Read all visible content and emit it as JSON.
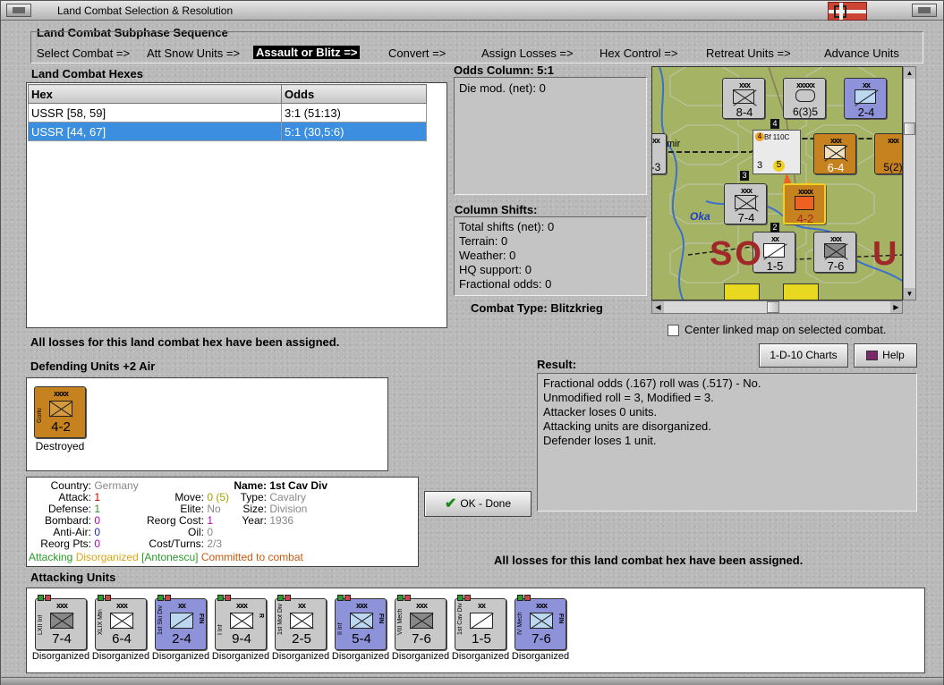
{
  "window": {
    "title": "Land Combat Selection & Resolution"
  },
  "subphase": {
    "heading": "Land Combat Subphase Sequence",
    "steps": [
      "Select Combat =>",
      "Att Snow Units =>",
      "Assault or Blitz =>",
      "Convert =>",
      "Assign Losses =>",
      "Hex Control =>",
      "Retreat Units =>",
      "Advance Units"
    ]
  },
  "hexes": {
    "heading": "Land Combat Hexes",
    "columns": [
      "Hex",
      "Odds"
    ],
    "rows": [
      {
        "hex": "USSR [58, 59]",
        "odds": "3:1 (51:13)"
      },
      {
        "hex": "USSR [44, 67]",
        "odds": "5:1 (30,5:6)"
      }
    ]
  },
  "odds": {
    "heading": "Odds Column: 5:1",
    "die_mod": "Die mod. (net): 0"
  },
  "shifts": {
    "heading": "Column Shifts:",
    "lines": [
      "Total shifts (net): 0",
      "Terrain: 0",
      "Weather: 0",
      "HQ support: 0",
      "Fractional odds: 0"
    ]
  },
  "combat_type": "Combat Type:  Blitzkrieg",
  "map": {
    "label_city": "mir",
    "label_river": "Oka",
    "label_region": "SO",
    "label_region2": "U",
    "aircraft": "Bf 110C",
    "counters": [
      {
        "str": "8-4",
        "size": "xxx"
      },
      {
        "str": "6(3)5",
        "size": "xxxxx"
      },
      {
        "str": "2-4",
        "size": "xx"
      },
      {
        "str": "6-4",
        "size": "xxx"
      },
      {
        "str": "5(2)",
        "size": "xxx"
      },
      {
        "str": "-3",
        "size": "xx"
      },
      {
        "str": "7-4",
        "size": "xxx"
      },
      {
        "str": "4-2",
        "size": "xxxx"
      },
      {
        "str": "1-5",
        "size": "xx"
      },
      {
        "str": "7-6",
        "size": "xxx"
      }
    ],
    "stack_numbers": [
      "4",
      "5",
      "3",
      "2",
      "4",
      "3"
    ]
  },
  "center_map": "Center linked map on selected combat.",
  "buttons": {
    "charts": "1-D-10 Charts",
    "help": "Help",
    "ok": "OK - Done"
  },
  "losses_msg_top": "All losses for this land combat hex have been assigned.",
  "losses_msg_bottom": "All losses for this land combat hex have been assigned.",
  "defending": {
    "heading": "Defending Units +2 Air",
    "unit": {
      "size": "xxxx",
      "side": "Gorki",
      "str": "4-2",
      "status": "Destroyed"
    }
  },
  "result": {
    "heading": "Result:",
    "lines": [
      "Fractional odds (.167) roll was (.517)  - No.",
      "Unmodified roll = 3, Modified = 3.",
      "Attacker loses 0 units.",
      "Attacking units are disorganized.",
      "Defender loses 1 unit."
    ]
  },
  "unit_info": {
    "country_label": "Country:",
    "country": "Germany",
    "attack_label": "Attack:",
    "attack": "1",
    "defense_label": "Defense:",
    "defense": "1",
    "bombard_label": "Bombard:",
    "bombard": "0",
    "antiair_label": "Anti-Air:",
    "antiair": "0",
    "reorgpts_label": "Reorg Pts:",
    "reorgpts": "0",
    "move_label": "Move:",
    "move": "0 (5)",
    "elite_label": "Elite:",
    "elite": "No",
    "reorgcost_label": "Reorg Cost:",
    "reorgcost": "1",
    "oil_label": "Oil:",
    "oil": "0",
    "costturns_label": "Cost/Turns:",
    "costturns": "2/3",
    "name_label": "Name:",
    "name": "1st Cav Div",
    "type_label": "Type:",
    "type": "Cavalry",
    "size_label": "Size:",
    "size": "Division",
    "year_label": "Year:",
    "year": "1936",
    "flag_attacking": "Attacking",
    "flag_disorganized": "Disorganized",
    "flag_antonescu": "[Antonescu]",
    "flag_committed": "Committed to combat",
    "colors": {
      "attacking": "#2a9a2a",
      "disorganized": "#d9a516",
      "antonescu": "#2a9a2a",
      "committed": "#c85a10"
    }
  },
  "attacking": {
    "heading": "Attacking Units",
    "units": [
      {
        "side": "LXII Inf",
        "size": "xxx",
        "str": "7-4",
        "status": "Disorganized",
        "nat": ""
      },
      {
        "side": "XLIX Mtn",
        "size": "xxx",
        "str": "6-4",
        "status": "Disorganized",
        "nat": ""
      },
      {
        "side": "1st Ski Div",
        "size": "xx",
        "str": "2-4",
        "status": "Disorganized",
        "nat": "FIN"
      },
      {
        "side": "I Inf",
        "size": "xxx",
        "str": "9-4",
        "status": "Disorganized",
        "nat": "R"
      },
      {
        "side": "1st Mot Div",
        "size": "xx",
        "str": "2-5",
        "status": "Disorganized",
        "nat": ""
      },
      {
        "side": "II Inf",
        "size": "xxx",
        "str": "5-4",
        "status": "Disorganized",
        "nat": "FIN"
      },
      {
        "side": "VIII Mech",
        "size": "xxx",
        "str": "7-6",
        "status": "Disorganized",
        "nat": ""
      },
      {
        "side": "1st Cav Div",
        "size": "xx",
        "str": "1-5",
        "status": "Disorganized",
        "nat": ""
      },
      {
        "side": "IV Mech",
        "size": "xxx",
        "str": "7-6",
        "status": "Disorganized",
        "nat": "FIN"
      }
    ]
  }
}
